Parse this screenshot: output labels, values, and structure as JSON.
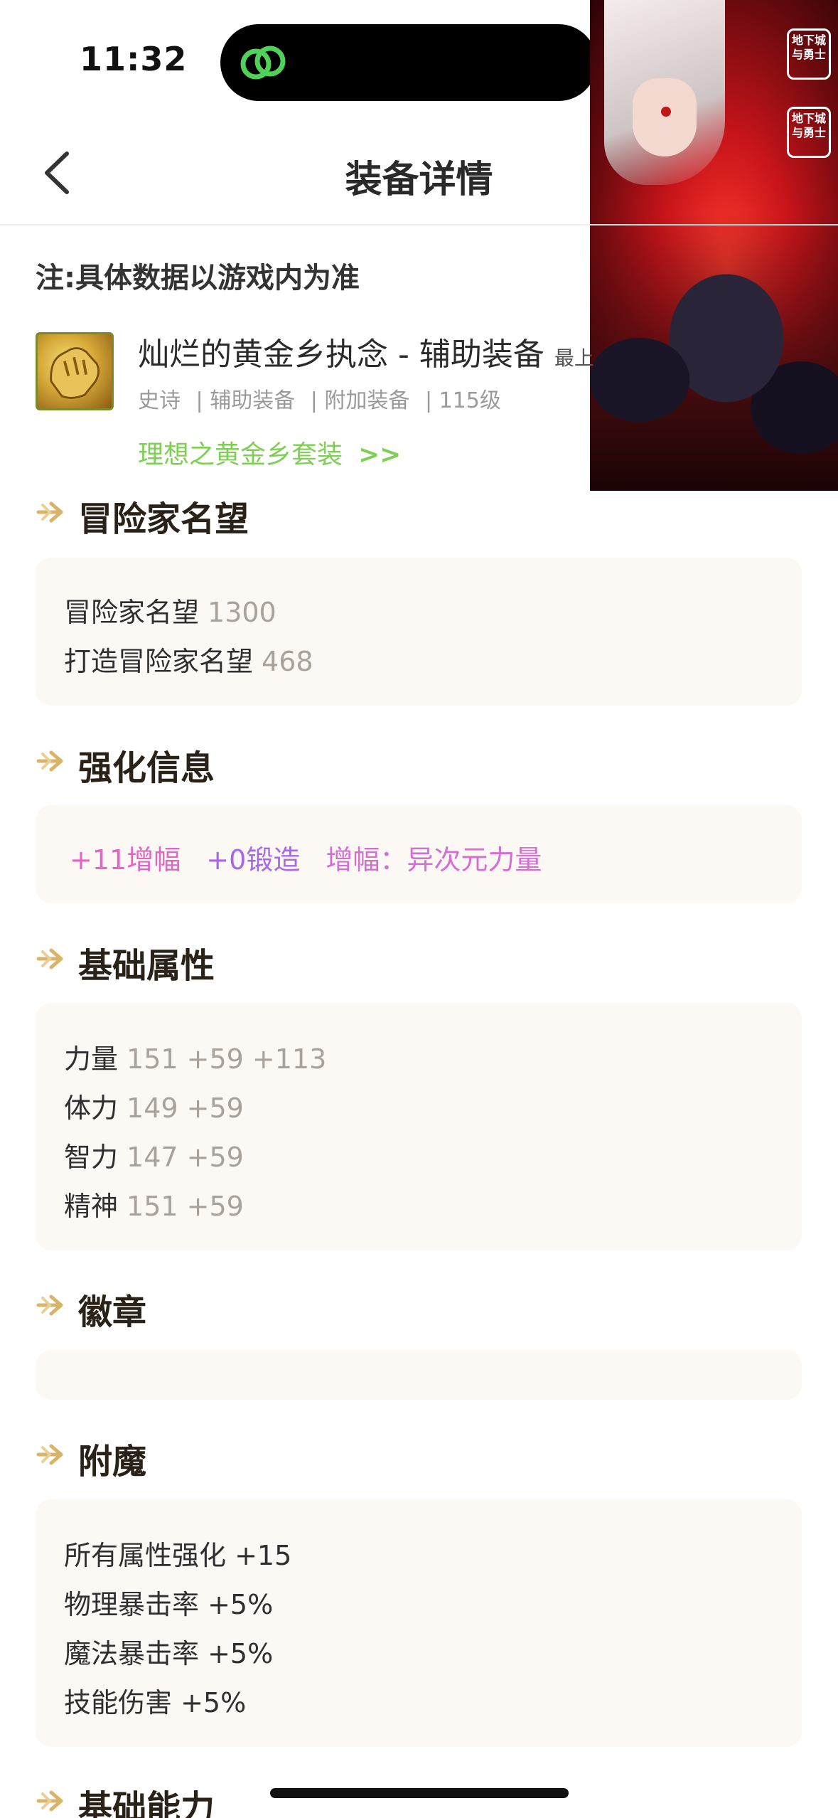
{
  "status_bar": {
    "time": "11:32",
    "island_icon": "link-rings-icon"
  },
  "nav": {
    "title": "装备详情",
    "back_icon": "chevron-left-icon"
  },
  "note": "注:具体数据以游戏内为准",
  "item": {
    "icon": "golden-gauntlet-icon",
    "name": "灿烂的黄金乡执念 - 辅助装备",
    "name_extra": "最上",
    "meta": [
      "史诗",
      "| 辅助装备",
      "| 附加装备",
      "| 115级"
    ],
    "set_name": "理想之黄金乡套装",
    "set_arrows": ">>"
  },
  "sections": {
    "reputation": {
      "title": "冒险家名望",
      "lines": [
        {
          "label": "冒险家名望",
          "value": "1300"
        },
        {
          "label": "打造冒险家名望",
          "value": "468"
        }
      ]
    },
    "enhance": {
      "title": "强化信息",
      "amp": "+11增幅",
      "forge": "+0锻造",
      "tag": "增幅：异次元力量"
    },
    "base_stats": {
      "title": "基础属性",
      "lines": [
        {
          "label": "力量",
          "value": "151 +59 +113"
        },
        {
          "label": "体力",
          "value": "149 +59"
        },
        {
          "label": "智力",
          "value": "147 +59"
        },
        {
          "label": "精神",
          "value": "151 +59"
        }
      ]
    },
    "emblem": {
      "title": "徽章"
    },
    "enchant": {
      "title": "附魔",
      "lines": [
        "所有属性强化 +15",
        "物理暴击率 +5%",
        "魔法暴击率 +5%",
        "技能伤害 +5%"
      ]
    },
    "base_ability": {
      "title": "基础能力"
    }
  },
  "promo_logos": [
    "地下城与勇士",
    "地下城与勇士"
  ],
  "colors": {
    "accent_green": "#7fcf55",
    "amp_pink": "#e066c4",
    "forge_purple": "#a768e6",
    "card_bg": "#fcf8f4",
    "section_arrow": "#d8b46a"
  }
}
